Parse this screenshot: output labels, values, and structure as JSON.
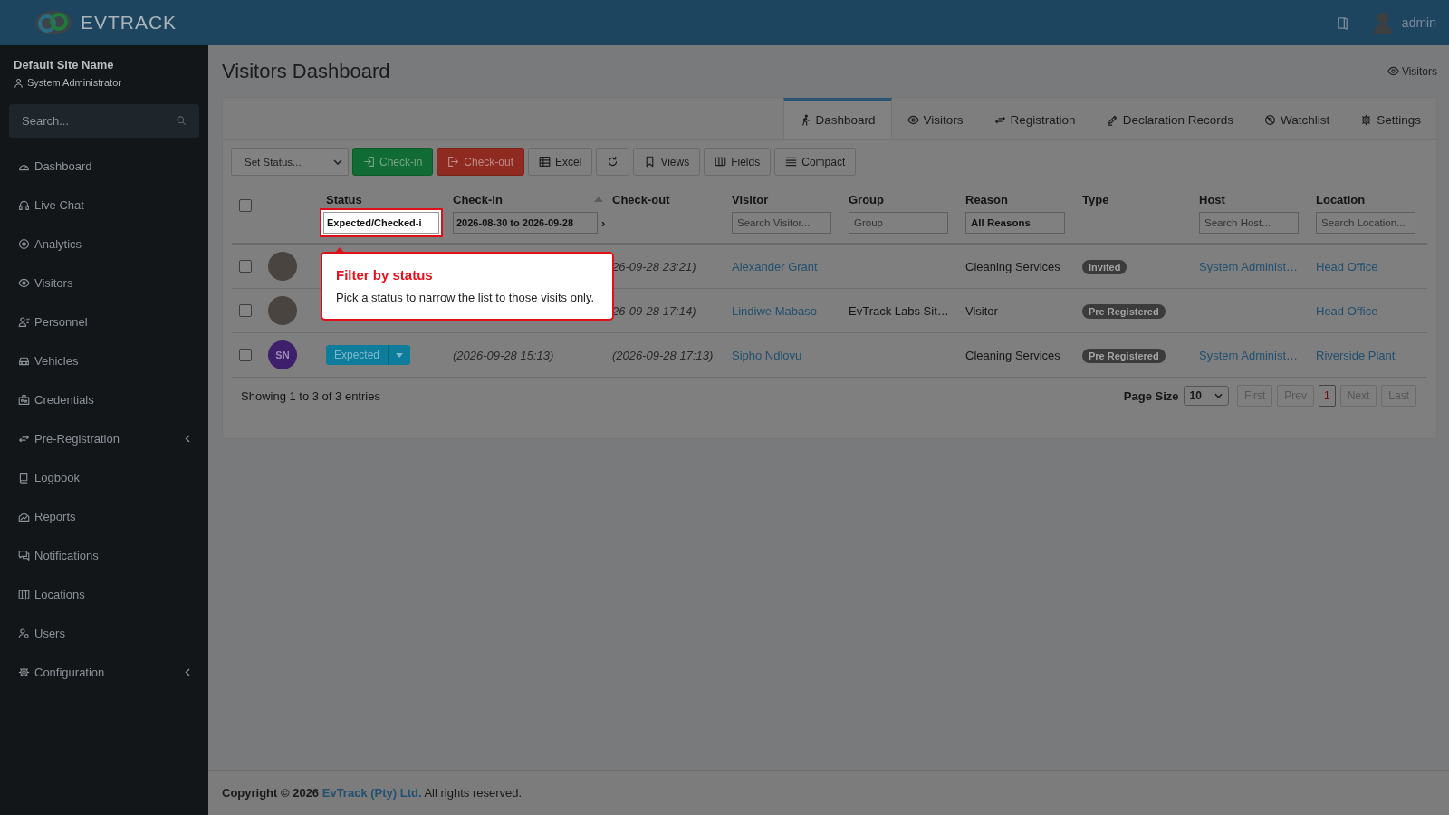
{
  "brand": {
    "logo_text": "**EV**TRACK"
  },
  "topbar": {
    "user": "admin"
  },
  "sidebar": {
    "site_name": "Default Site Name",
    "user_role": "System Administrator",
    "search_placeholder": "Search...",
    "items": [
      {
        "label": "Dashboard",
        "has_submenu": false
      },
      {
        "label": "Live Chat",
        "has_submenu": false
      },
      {
        "label": "Analytics",
        "has_submenu": false
      },
      {
        "label": "Visitors",
        "has_submenu": false
      },
      {
        "label": "Personnel",
        "has_submenu": false
      },
      {
        "label": "Vehicles",
        "has_submenu": false
      },
      {
        "label": "Credentials",
        "has_submenu": false
      },
      {
        "label": "Pre-Registration",
        "has_submenu": true
      },
      {
        "label": "Logbook",
        "has_submenu": false
      },
      {
        "label": "Reports",
        "has_submenu": false
      },
      {
        "label": "Notifications",
        "has_submenu": false
      },
      {
        "label": "Locations",
        "has_submenu": false
      },
      {
        "label": "Users",
        "has_submenu": false
      },
      {
        "label": "Configuration",
        "has_submenu": true
      }
    ]
  },
  "page": {
    "title": "Visitors Dashboard",
    "breadcrumb": "Visitors"
  },
  "tabs": [
    {
      "label": "Dashboard",
      "selected": true
    },
    {
      "label": "Visitors",
      "selected": false
    },
    {
      "label": "Registration",
      "selected": false
    },
    {
      "label": "Declaration Records",
      "selected": false
    },
    {
      "label": "Watchlist",
      "selected": false
    },
    {
      "label": "Settings",
      "selected": false
    }
  ],
  "toolbar": {
    "set_status": "Set Status...",
    "buttons": [
      {
        "label": "Check-in",
        "kind": "checkin"
      },
      {
        "label": "Check-out",
        "kind": "checkout"
      },
      {
        "label": "Excel",
        "kind": "excel"
      },
      {
        "kind": "refresh"
      },
      {
        "label": "Views",
        "kind": "views"
      },
      {
        "label": "Fields",
        "kind": "fields"
      },
      {
        "label": "Compact",
        "kind": "compact"
      }
    ]
  },
  "table": {
    "select_all_checked": false,
    "columns": [
      {
        "label": "Status",
        "sorted": false,
        "filter": {
          "kind": "input",
          "highlighted": true,
          "value": "Expected/Checked-i"
        }
      },
      {
        "label": "Check-in",
        "sorted": true,
        "filter": {
          "kind": "range",
          "highlighted": false,
          "value": "2026-08-30 to 2026-09-28",
          "next": "›"
        }
      },
      {
        "label": "Check-out",
        "sorted": false
      },
      {
        "label": "Visitor",
        "sorted": false,
        "filter": {
          "kind": "input",
          "highlighted": false,
          "placeholder": "Search Visitor..."
        }
      },
      {
        "label": "Group",
        "sorted": false,
        "filter": {
          "kind": "input",
          "highlighted": false,
          "placeholder": "Group"
        }
      },
      {
        "label": "Reason",
        "sorted": false,
        "filter": {
          "kind": "input",
          "highlighted": false,
          "value": "All Reasons"
        }
      },
      {
        "label": "Type",
        "sorted": false
      },
      {
        "label": "Host",
        "sorted": false,
        "filter": {
          "kind": "input",
          "highlighted": false,
          "placeholder": "Search Host..."
        }
      },
      {
        "label": "Location",
        "sorted": false,
        "filter": {
          "kind": "input",
          "highlighted": false,
          "placeholder": "Search Location..."
        }
      }
    ],
    "rows": [
      {
        "checked": false,
        "avatar": {
          "kind": "photo"
        },
        "check_out": "26-09-28 23:21)",
        "visitor": "Alexander Grant",
        "reason": "Cleaning Services",
        "type": "Invited",
        "host": "System Administ…",
        "location": "Head Office"
      },
      {
        "checked": false,
        "avatar": {
          "kind": "photo"
        },
        "check_out": "26-09-28 17:14)",
        "visitor": "Lindiwe Mabaso",
        "group": "EvTrack Labs Sit…",
        "reason": "Visitor",
        "type": "Pre Registered",
        "location": "Head Office"
      },
      {
        "checked": false,
        "avatar": {
          "kind": "initials",
          "initials": "SN"
        },
        "status": "Expected",
        "check_in": "(2026-09-28 15:13)",
        "check_out": "(2026-09-28 17:13)",
        "visitor": "Sipho Ndlovu",
        "reason": "Cleaning Services",
        "type": "Pre Registered",
        "host": "System Administ…",
        "location": "Riverside Plant"
      }
    ],
    "summary": "Showing 1 to 3 of 3 entries",
    "page_size_label": "Page Size",
    "page_size": "10",
    "pager": [
      {
        "label": "First",
        "kind": "nav",
        "disabled": true,
        "selected": false
      },
      {
        "label": "Prev",
        "kind": "nav",
        "disabled": true,
        "selected": false
      },
      {
        "label": "1",
        "kind": "page",
        "disabled": false,
        "selected": true
      },
      {
        "label": "Next",
        "kind": "nav",
        "disabled": true,
        "selected": false
      },
      {
        "label": "Last",
        "kind": "nav",
        "disabled": true,
        "selected": false
      }
    ]
  },
  "tour": {
    "title": "Filter by status",
    "text": "Pick a status to narrow the list to those visits only."
  },
  "footer": {
    "copyright": "Copyright © 2026",
    "company": "EvTrack (Pty) Ltd.",
    "rights": "All rights reserved."
  }
}
